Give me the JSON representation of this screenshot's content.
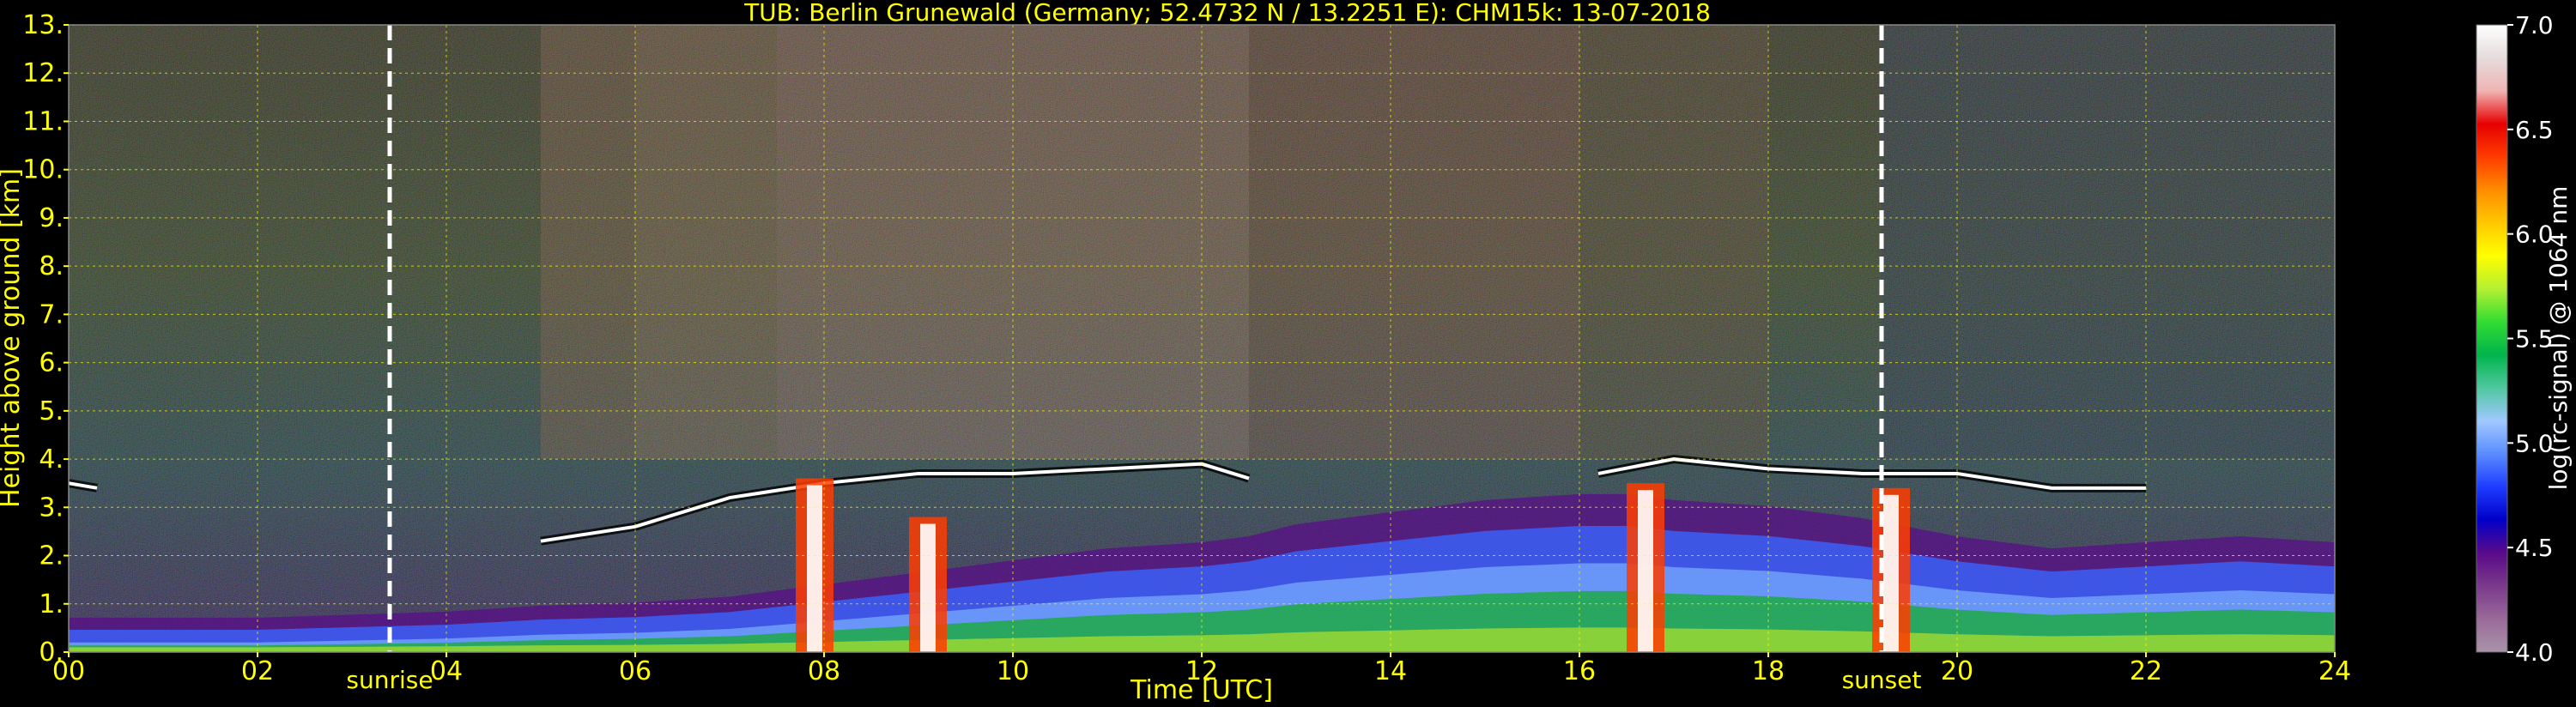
{
  "chart_data": {
    "type": "heatmap",
    "title": "TUB: Berlin Grunewald (Germany; 52.4732 N / 13.2251 E):    CHM15k: 13-07-2018",
    "xlabel": "Time [UTC]",
    "ylabel": "Height above ground [km]",
    "xlim": [
      0,
      24
    ],
    "ylim": [
      0,
      13
    ],
    "x_ticks": [
      0,
      2,
      4,
      6,
      8,
      10,
      12,
      14,
      16,
      18,
      20,
      22,
      24
    ],
    "x_tick_labels": [
      "00",
      "02",
      "04",
      "06",
      "08",
      "10",
      "12",
      "14",
      "16",
      "18",
      "20",
      "22",
      "24"
    ],
    "y_ticks": [
      0,
      1,
      2,
      3,
      4,
      5,
      6,
      7,
      8,
      9,
      10,
      11,
      12,
      13
    ],
    "y_tick_labels": [
      "0.",
      "1.",
      "2.",
      "3.",
      "4.",
      "5.",
      "6.",
      "7.",
      "8.",
      "9.",
      "10.",
      "11.",
      "12.",
      "13."
    ],
    "grid": true,
    "colorbar": {
      "label": "log(rc-signal) @ 1064 nm",
      "range": [
        4.0,
        7.0
      ],
      "ticks": [
        4.0,
        4.5,
        5.0,
        5.5,
        6.0,
        6.5,
        7.0
      ],
      "tick_labels": [
        "4.0",
        "4.5",
        "5.0",
        "5.5",
        "6.0",
        "6.5",
        "7.0"
      ],
      "colors": [
        "#a894a8",
        "#9a6a9a",
        "#7a3a8a",
        "#5a0a8a",
        "#0000c8",
        "#1e3cff",
        "#5a8cff",
        "#a0c8ff",
        "#50c8a0",
        "#00b44b",
        "#32dc32",
        "#b4f032",
        "#ffff00",
        "#ffc800",
        "#ff8c00",
        "#ff3c00",
        "#e60000",
        "#f0b4b4",
        "#e6dcdc",
        "#ffffff"
      ]
    },
    "events": [
      {
        "name": "sunrise",
        "x": 3.4
      },
      {
        "name": "sunset",
        "x": 19.2
      }
    ],
    "boundary_layer_top_km": {
      "x": [
        0,
        0.5,
        1,
        2,
        3,
        4,
        5,
        6,
        7,
        8,
        9,
        10,
        11,
        12,
        12.5,
        13,
        14,
        15,
        16,
        16.5,
        17,
        18,
        19,
        20,
        21,
        22,
        23,
        24
      ],
      "y": [
        0.25,
        0.25,
        0.25,
        0.25,
        0.3,
        0.35,
        0.45,
        0.5,
        0.6,
        0.8,
        1.0,
        1.2,
        1.4,
        1.5,
        1.6,
        1.8,
        2.0,
        2.2,
        2.3,
        2.3,
        2.2,
        2.1,
        1.9,
        1.6,
        1.4,
        1.5,
        1.6,
        1.5
      ]
    },
    "cloud_layer_km": {
      "x": [
        0,
        0.3,
        5,
        6,
        7,
        8,
        9,
        10,
        11,
        12,
        12.5,
        16.2,
        17,
        18,
        19,
        20,
        21,
        22
      ],
      "y": [
        3.5,
        3.4,
        2.3,
        2.6,
        3.2,
        3.5,
        3.7,
        3.7,
        3.8,
        3.9,
        3.6,
        3.7,
        4.0,
        3.8,
        3.7,
        3.7,
        3.4,
        3.4
      ]
    },
    "precipitation_shafts": [
      {
        "x": 7.9,
        "top": 3.6
      },
      {
        "x": 9.1,
        "top": 2.8
      },
      {
        "x": 16.7,
        "top": 3.5
      },
      {
        "x": 19.3,
        "top": 3.4
      }
    ]
  }
}
